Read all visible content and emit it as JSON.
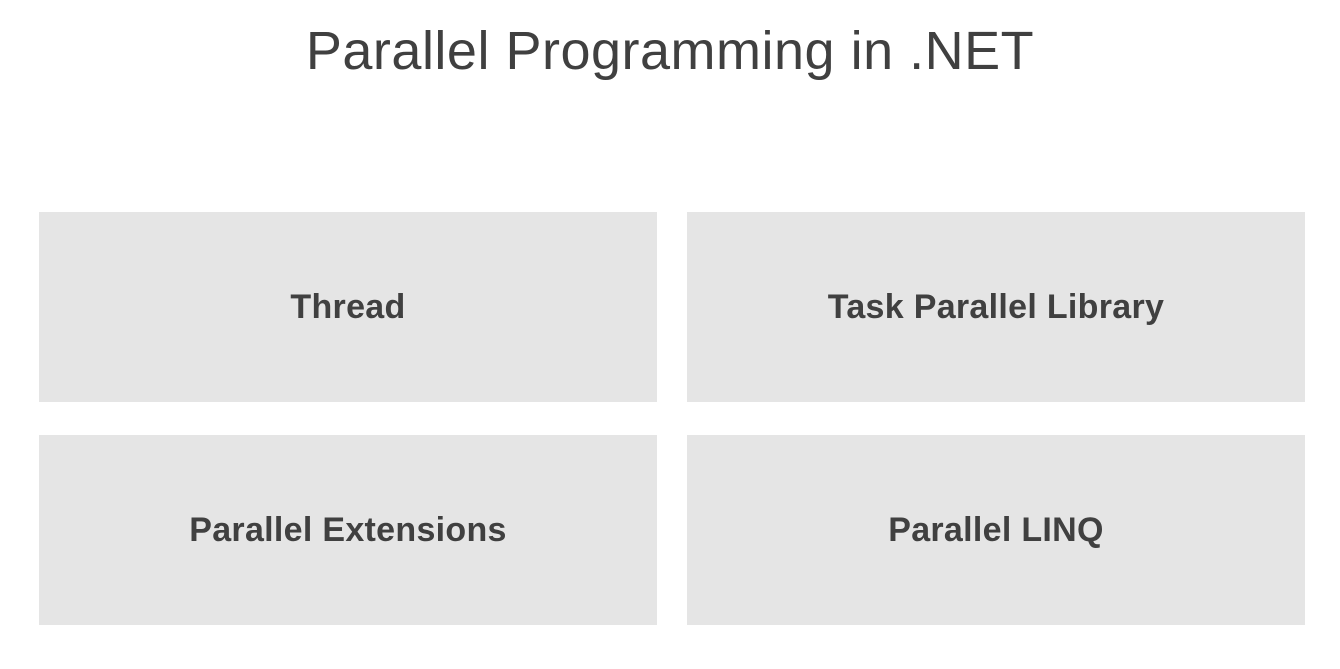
{
  "slide": {
    "title": "Parallel Programming in .NET",
    "tiles": [
      {
        "label": "Thread"
      },
      {
        "label": "Task Parallel Library"
      },
      {
        "label": "Parallel Extensions"
      },
      {
        "label": "Parallel LINQ"
      }
    ]
  },
  "colors": {
    "background": "#ffffff",
    "tile": "#e5e5e5",
    "text": "#404040"
  }
}
